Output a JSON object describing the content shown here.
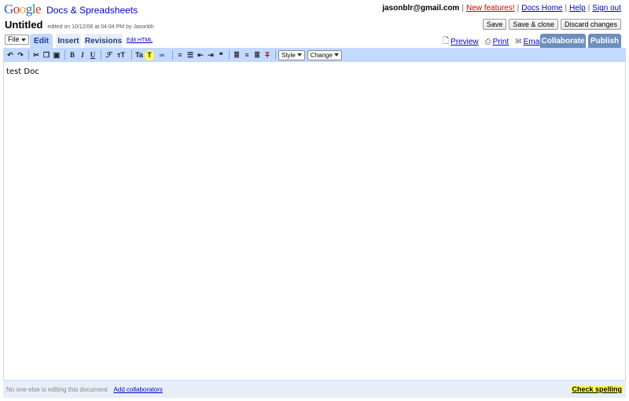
{
  "header": {
    "logo_text": "Google",
    "app_name": "Docs & Spreadsheets",
    "user_email": "jasonblr@gmail.com",
    "links": {
      "new_features": "New features!",
      "docs_home": "Docs Home",
      "help": "Help",
      "sign_out": "Sign out"
    },
    "separator": "|"
  },
  "document": {
    "title": "Untitled",
    "meta": "edited on 10/12/06 at 04:04 PM by Jasonblr",
    "body_text": "test Doc"
  },
  "save_buttons": {
    "save": "Save",
    "save_close": "Save & close",
    "discard": "Discard changes"
  },
  "menu": {
    "file": "File"
  },
  "tabs": {
    "edit": "Edit",
    "insert": "Insert",
    "revisions": "Revisions",
    "edit_html": "Edit HTML"
  },
  "actions": {
    "preview": "Preview",
    "print": "Print",
    "email": "Email",
    "collaborate": "Collaborate",
    "publish": "Publish"
  },
  "toolbar": {
    "style_label": "Style",
    "change_label": "Change",
    "icons": [
      "undo-icon",
      "redo-icon",
      "cut-icon",
      "copy-icon",
      "paste-icon",
      "bold-icon",
      "italic-icon",
      "underline-icon",
      "font-icon",
      "font-size-icon",
      "text-color-icon",
      "highlight-icon",
      "link-icon",
      "numbered-list-icon",
      "bulleted-list-icon",
      "outdent-icon",
      "indent-icon",
      "blockquote-icon",
      "align-left-icon",
      "align-center-icon",
      "align-right-icon",
      "clear-format-icon"
    ]
  },
  "status": {
    "editing_text": "No one else is editing this document",
    "add_collaborators": "Add collaborators",
    "check_spelling": "Check spelling"
  },
  "colors": {
    "tab_active": "#c3d9ff",
    "tab_inactive": "#e8eef7",
    "button_blue": "#6b8fbf",
    "link": "#0000cc",
    "highlight": "#ffff55"
  }
}
